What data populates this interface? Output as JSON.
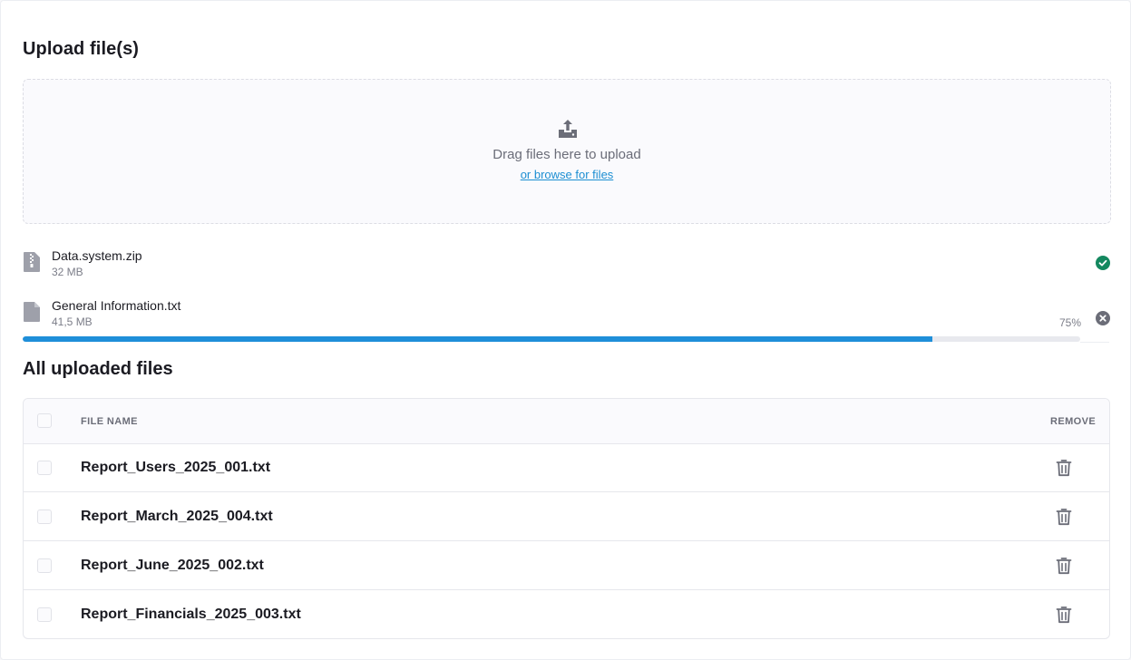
{
  "upload": {
    "title": "Upload file(s)",
    "drag_text": "Drag files here to upload",
    "browse_label": "or browse for files",
    "icon": "upload-tray-icon"
  },
  "uploads": [
    {
      "name": "Data.system.zip",
      "size": "32 MB",
      "status": "complete",
      "icon": "zip-file-icon",
      "status_icon": "check-circle-icon"
    },
    {
      "name": "General Information.txt",
      "size": "41,5 MB",
      "status": "uploading",
      "progress_label": "75%",
      "progress": 0.86,
      "icon": "file-icon",
      "status_icon": "cancel-circle-icon"
    }
  ],
  "uploaded": {
    "title": "All uploaded files",
    "columns": {
      "file_name": "FILE NAME",
      "remove": "REMOVE"
    },
    "rows": [
      {
        "name": "Report_Users_2025_001.txt"
      },
      {
        "name": "Report_March_2025_004.txt"
      },
      {
        "name": "Report_June_2025_002.txt"
      },
      {
        "name": "Report_Financials_2025_003.txt"
      }
    ]
  },
  "colors": {
    "accent": "#1f8fd9",
    "link": "#1c8ed2",
    "success": "#14885f",
    "cancel": "#6b6d78"
  }
}
